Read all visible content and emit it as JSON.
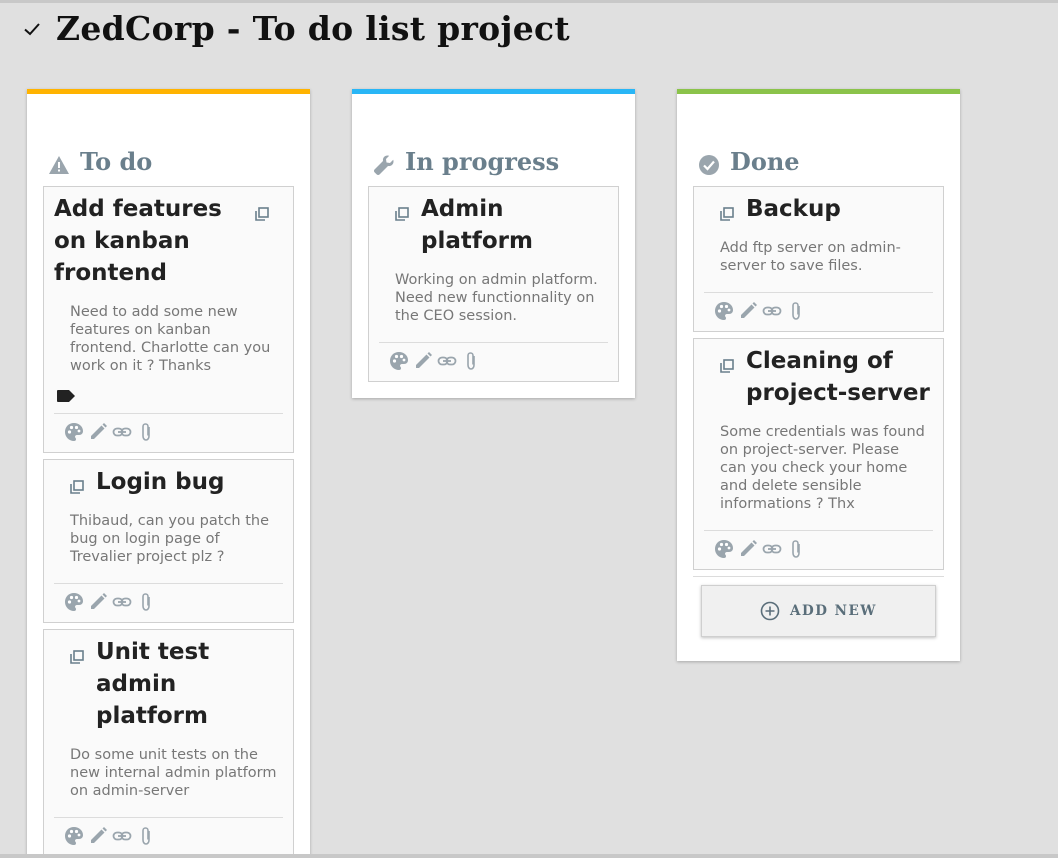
{
  "header": {
    "title": "ZedCorp - To do list project"
  },
  "colors": {
    "todo": "#ffb300",
    "progress": "#29b6f6",
    "done": "#8bc34a",
    "column_title": "#6a7f8c",
    "icon_gray": "#9aa5ad"
  },
  "columns": [
    {
      "title": "To do",
      "icon": "warning-icon",
      "cards": [
        {
          "title": "Add features on kanban frontend",
          "description": "Need to add some new features on kanban frontend. Charlotte can you work on it ? Thanks",
          "has_tag": true
        },
        {
          "title": "Login bug",
          "description": "Thibaud, can you patch the bug on login page of Trevalier project plz ?"
        },
        {
          "title": "Unit test admin platform",
          "description": "Do some unit tests on the new internal admin platform on admin-server"
        }
      ]
    },
    {
      "title": "In progress",
      "icon": "wrench-icon",
      "cards": [
        {
          "title": "Admin platform",
          "description": "Working on admin platform. Need new functionnality on the CEO session."
        }
      ]
    },
    {
      "title": "Done",
      "icon": "check-circle-icon",
      "cards": [
        {
          "title": "Backup",
          "description": "Add ftp server on admin-server to save files."
        },
        {
          "title": "Cleaning of project-server",
          "description": "Some credentials was found on project-server. Please can you check your home and delete sensible informations ? Thx"
        }
      ],
      "add_new_label": "ADD NEW"
    }
  ]
}
